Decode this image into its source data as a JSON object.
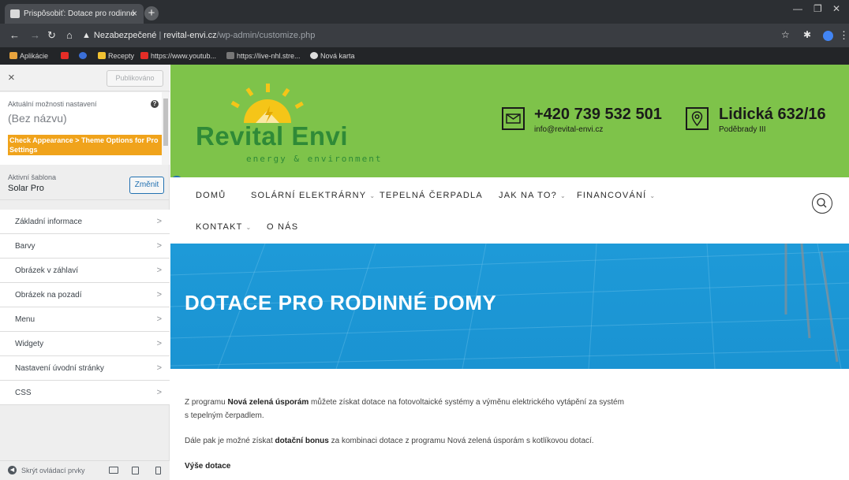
{
  "browser": {
    "tab_title": "Prispôsobiť: Dotace pro rodinné",
    "tab_close": "×",
    "new_tab": "+",
    "security": "Nezabezpečené",
    "url_host": "revital-envi.cz",
    "url_path": "/wp-admin/customize.php",
    "bookmarks": [
      "Aplikácie",
      "Recepty",
      "https://www.youtub...",
      "https://live-nhl.stre...",
      "Nová karta"
    ],
    "colors": {
      "tabbar": "#2c2f33",
      "addrbar": "#3a3d42"
    }
  },
  "sidebar": {
    "close": "×",
    "publish_label": "Publikováno",
    "info_label": "Aktuální možnosti nastavení",
    "info_title": "(Bez názvu)",
    "notice": "Check Appearance > Theme Options for Pro Settings",
    "theme_label": "Aktivní šablona",
    "theme_name": "Solar Pro",
    "change_button": "Změnit",
    "menu": [
      "Základní informace",
      "Barvy",
      "Obrázek v záhlaví",
      "Obrázek na pozadí",
      "Menu",
      "Widgety",
      "Nastavení úvodní stránky",
      "CSS"
    ],
    "hide_controls": "Skrýt ovládací prvky",
    "colors": {
      "accent": "#2271b1",
      "notice": "#f0a31b"
    }
  },
  "site": {
    "logo_name": "Revital Envi",
    "logo_tagline": "energy & environment",
    "phone": "+420 739 532 501",
    "email": "info@revital-envi.cz",
    "address": "Lidická 632/16",
    "city": "Poděbrady III",
    "nav": {
      "home": "DOMŮ",
      "solar": "SOLÁRNÍ ELEKTRÁRNY",
      "heat": "TEPELNÁ ČERPADLA",
      "howto": "JAK NA TO?",
      "finance": "FINANCOVÁNÍ",
      "contact": "KONTAKT",
      "about": "O NÁS"
    },
    "hero_title": "DOTACE PRO RODINNÉ DOMY",
    "p1_a": "Z programu ",
    "p1_b": "Nová zelená úsporám",
    "p1_c": " můžete získat dotace na fotovoltaické systémy a výměnu elektrického vytápění za systém",
    "p1_d": "s tepelným čerpadlem.",
    "p2_a": "Dále pak je možné získat ",
    "p2_b": "dotační bonus",
    "p2_c": " za kombinaci dotace z programu Nová zelená úsporám s kotlíkovou dotací.",
    "p3": "Výše dotace",
    "colors": {
      "header": "#7ec34a",
      "logo": "#2f8a37",
      "sun": "#f5c518",
      "hero": "#1e9ad8"
    }
  }
}
